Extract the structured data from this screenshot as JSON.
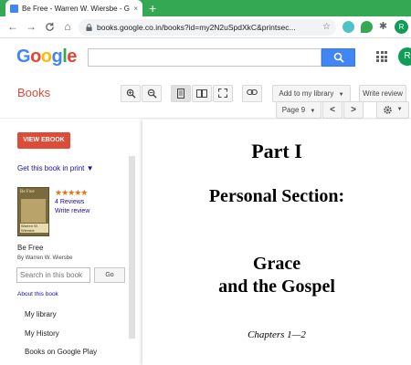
{
  "browser": {
    "tab_title": "Be Free - Warren W. Wiersbe - G",
    "tab_close": "×",
    "new_tab": "+",
    "url": "books.google.co.in/books?id=my2N2uSpdXkC&printsec...",
    "profile_initial": "R",
    "back_icon": "←",
    "forward_icon": "→",
    "reload_icon": "C",
    "home_icon": "⌂",
    "star_icon": "☆",
    "extensions_icon": "✱"
  },
  "google": {
    "logo": [
      "G",
      "o",
      "o",
      "g",
      "l",
      "e"
    ],
    "logo_colors": [
      "#4285f4",
      "#ea4335",
      "#fbbc05",
      "#4285f4",
      "#34a853",
      "#ea4335"
    ],
    "avatar_initial": "R"
  },
  "toolbar": {
    "books_label": "Books",
    "add_to_library": "Add to my library",
    "write_review": "Write review",
    "page": "Page 9",
    "prev": "<",
    "next": ">"
  },
  "sidebar": {
    "view_ebook": "VIEW EBOOK",
    "get_print": "Get this book in print ▼",
    "cover_title": "Be Free",
    "cover_author": "Warren W. Wiersbe",
    "stars": "★★★★★",
    "reviews": "4 Reviews",
    "write_review": "Write review",
    "book_title": "Be Free",
    "book_author": "By Warren W. Wiersbe",
    "search_placeholder": "Search in this book",
    "go": "Go",
    "about": "About this book",
    "links": [
      "My library",
      "My History",
      "Books on Google Play"
    ]
  },
  "page_content": {
    "part": "Part I",
    "section": "Personal Section:",
    "grace_line1": "Grace",
    "grace_line2": "and the Gospel",
    "chapters": "Chapters 1—2"
  },
  "colors": {
    "accent_red": "#dd4b39",
    "link_blue": "#1a0dab",
    "chrome_green": "#34a853",
    "search_blue": "#4285f4"
  }
}
